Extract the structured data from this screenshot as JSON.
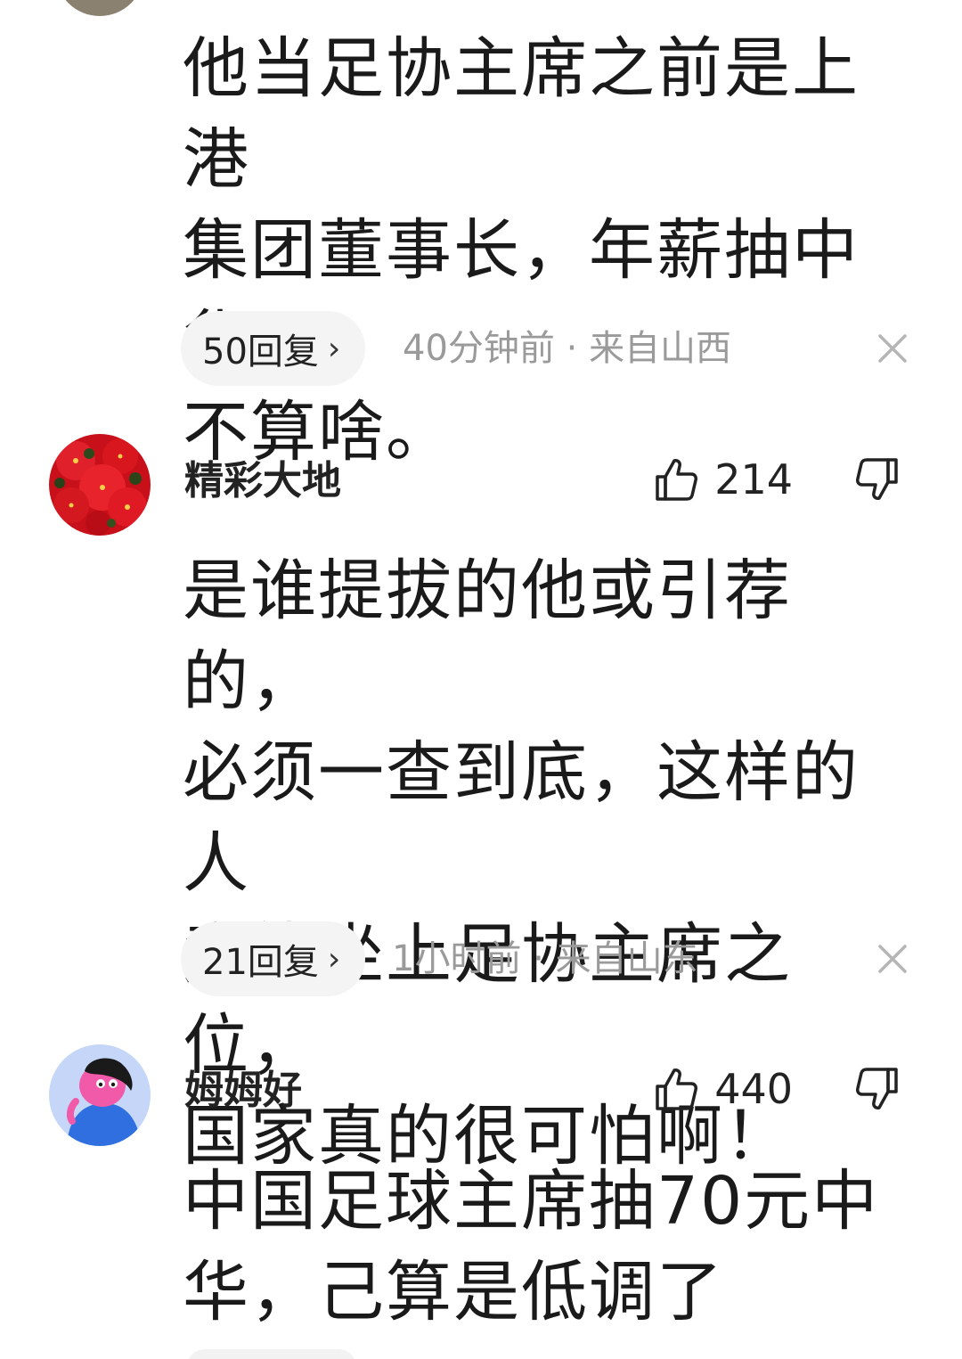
{
  "comments": [
    {
      "content": "他当足协主席之前是上港\n集团董事长，年薪抽中华\n不算啥。",
      "replies_label": "50回复",
      "time": "40分钟前",
      "location": "来自山西",
      "meta_separator": "·"
    },
    {
      "username": "精彩大地",
      "likes": "214",
      "content": "是谁提拔的他或引荐的，\n必须一查到底，这样的人\n竟能坐上足协主席之位，\n国家真的很可怕啊！",
      "replies_label": "21回复",
      "time": "1小时前",
      "location": "来自山东",
      "meta_separator": "·",
      "avatar_icon": "red-flower-avatar"
    },
    {
      "username": "姆姆好",
      "likes": "440",
      "content": "中国足球主席抽70元中\n华，己算是低调了",
      "avatar_icon": "cartoon-character-avatar"
    }
  ],
  "icons": {
    "like": "thumbs-up-icon",
    "dislike": "thumbs-down-icon",
    "close": "close-icon",
    "chevron": "chevron-right-icon"
  },
  "colors": {
    "meta_text": "#9a9a9a",
    "pill_bg": "#f4f4f4",
    "text": "#1a1a1a"
  }
}
